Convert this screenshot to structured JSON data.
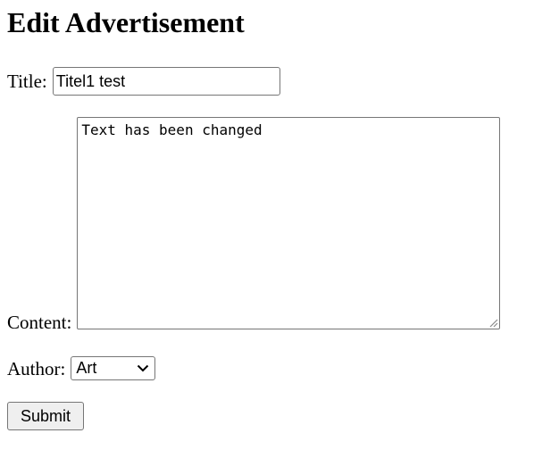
{
  "page": {
    "heading": "Edit Advertisement"
  },
  "form": {
    "title_label": "Title:",
    "title_value": "Titel1 test",
    "content_label": "Content:",
    "content_value": "Text has been changed",
    "author_label": "Author:",
    "author_selected": "Art",
    "submit_label": "Submit"
  },
  "icons": {
    "select_arrow": "chevron-down-icon",
    "textarea_resize": "resize-grip-icon"
  },
  "colors": {
    "border": "#767676",
    "button_bg": "#efefef"
  }
}
